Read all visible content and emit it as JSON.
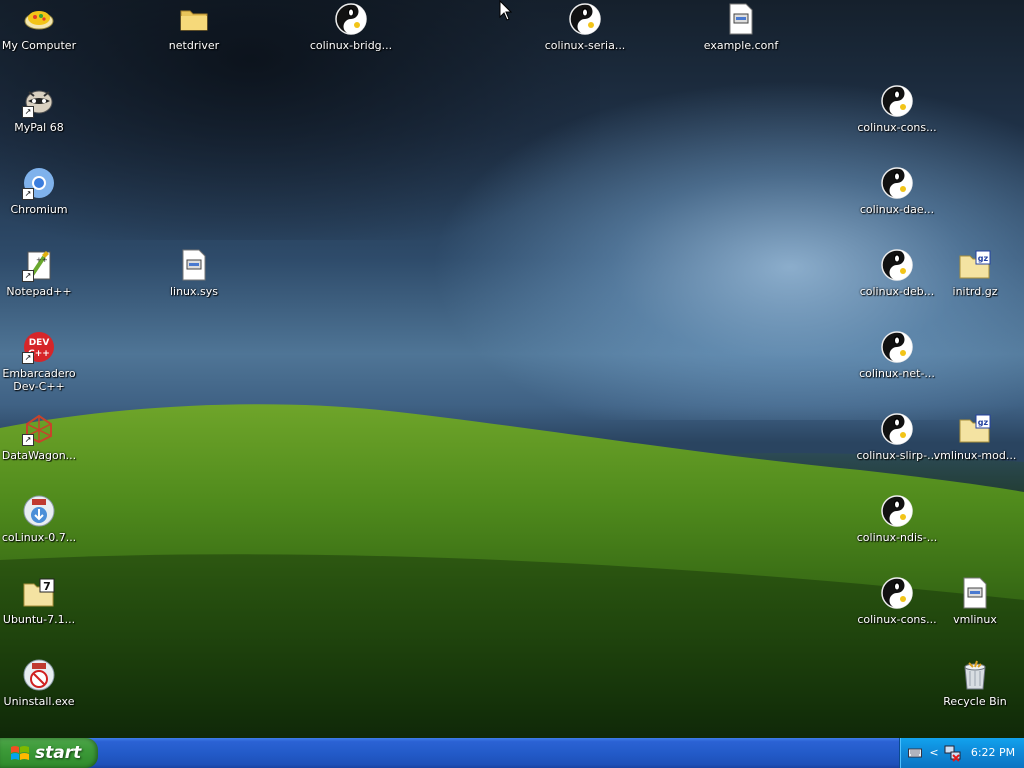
{
  "desktop": {
    "icons": [
      {
        "label": "My Computer",
        "icon": "my-computer-icon"
      },
      {
        "label": "netdriver",
        "icon": "folder-icon"
      },
      {
        "label": "colinux-bridg...",
        "icon": "colinux-icon"
      },
      {
        "label": "colinux-seria...",
        "icon": "colinux-icon"
      },
      {
        "label": "example.conf",
        "icon": "text-file-icon"
      },
      {
        "label": "MyPal 68",
        "icon": "mypal-icon"
      },
      {
        "label": "Chromium",
        "icon": "chromium-icon"
      },
      {
        "label": "Notepad++",
        "icon": "notepadpp-icon"
      },
      {
        "label": "linux.sys",
        "icon": "system-file-icon"
      },
      {
        "label": "Embarcadero Dev-C++",
        "icon": "devcpp-icon"
      },
      {
        "label": "DataWagon...",
        "icon": "datawagon-icon"
      },
      {
        "label": "coLinux-0.7...",
        "icon": "installer-icon"
      },
      {
        "label": "Ubuntu-7.1...",
        "icon": "7z-archive-icon"
      },
      {
        "label": "Uninstall.exe",
        "icon": "uninstall-icon"
      },
      {
        "label": "colinux-cons...",
        "icon": "colinux-icon"
      },
      {
        "label": "colinux-dae...",
        "icon": "colinux-icon"
      },
      {
        "label": "colinux-deb...",
        "icon": "colinux-icon"
      },
      {
        "label": "initrd.gz",
        "icon": "gz-archive-icon"
      },
      {
        "label": "colinux-net-...",
        "icon": "colinux-icon"
      },
      {
        "label": "colinux-slirp-...",
        "icon": "colinux-icon"
      },
      {
        "label": "vmlinux-mod...",
        "icon": "gz-archive-icon"
      },
      {
        "label": "colinux-ndis-...",
        "icon": "colinux-icon"
      },
      {
        "label": "colinux-cons...",
        "icon": "colinux-icon"
      },
      {
        "label": "vmlinux",
        "icon": "system-file-icon"
      },
      {
        "label": "Recycle Bin",
        "icon": "recycle-bin-icon"
      }
    ]
  },
  "taskbar": {
    "start_label": "start",
    "clock": "6:22 PM"
  },
  "colors": {
    "taskbar_blue": "#235bc9",
    "start_green": "#3c9a38",
    "tray_blue": "#0f8ad9"
  }
}
